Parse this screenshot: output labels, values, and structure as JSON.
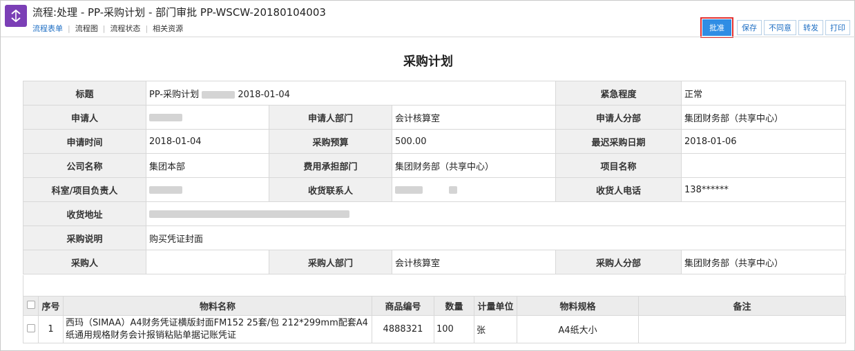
{
  "header": {
    "title": "流程:处理 - PP-采购计划 - 部门审批 PP-WSCW-20180104003",
    "tabs": [
      {
        "label": "流程表单",
        "active": true
      },
      {
        "label": "流程图",
        "active": false
      },
      {
        "label": "流程状态",
        "active": false
      },
      {
        "label": "相关资源",
        "active": false
      }
    ],
    "icon": "workflow-app-icon",
    "accent": "#7b3fb6"
  },
  "toolbar": {
    "approve": "批准",
    "save": "保存",
    "disagree": "不同意",
    "forward": "转发",
    "print": "打印"
  },
  "form": {
    "title": "采购计划",
    "labels": {
      "subject": "标题",
      "urgency": "紧急程度",
      "applicant": "申请人",
      "applicant_dept": "申请人部门",
      "applicant_division": "申请人分部",
      "apply_time": "申请时间",
      "budget": "采购预算",
      "latest_date": "最迟采购日期",
      "company": "公司名称",
      "cost_dept": "费用承担部门",
      "project_name": "项目名称",
      "owner": "科室/项目负责人",
      "receiver": "收货联系人",
      "receiver_phone": "收货人电话",
      "address": "收货地址",
      "description": "采购说明",
      "purchaser": "采购人",
      "purchaser_dept": "采购人部门",
      "purchaser_division": "采购人分部"
    },
    "values": {
      "subject_prefix": "PP-采购计划",
      "subject_date": "2018-01-04",
      "urgency": "正常",
      "applicant_dept": "会计核算室",
      "applicant_division": "集团财务部（共享中心）",
      "apply_time": "2018-01-04",
      "budget": "500.00",
      "latest_date": "2018-01-06",
      "company": "集团本部",
      "cost_dept": "集团财务部（共享中心）",
      "project_name": "",
      "receiver_phone": "138******",
      "description": "购买凭证封面",
      "purchaser": "",
      "purchaser_dept": "会计核算室",
      "purchaser_division": "集团财务部（共享中心）"
    }
  },
  "items": {
    "columns": [
      "序号",
      "物料名称",
      "商品编号",
      "数量",
      "计量单位",
      "物料规格",
      "备注"
    ],
    "rows": [
      {
        "index": "1",
        "name": "西玛（SIMAA）A4财务凭证横版封面FM152 25套/包 212*299mm配套A4纸通用规格财务会计报销粘贴单据记账凭证",
        "code": "4888321",
        "qty": "100",
        "unit": "张",
        "spec": "A4纸大小",
        "note": ""
      }
    ]
  }
}
